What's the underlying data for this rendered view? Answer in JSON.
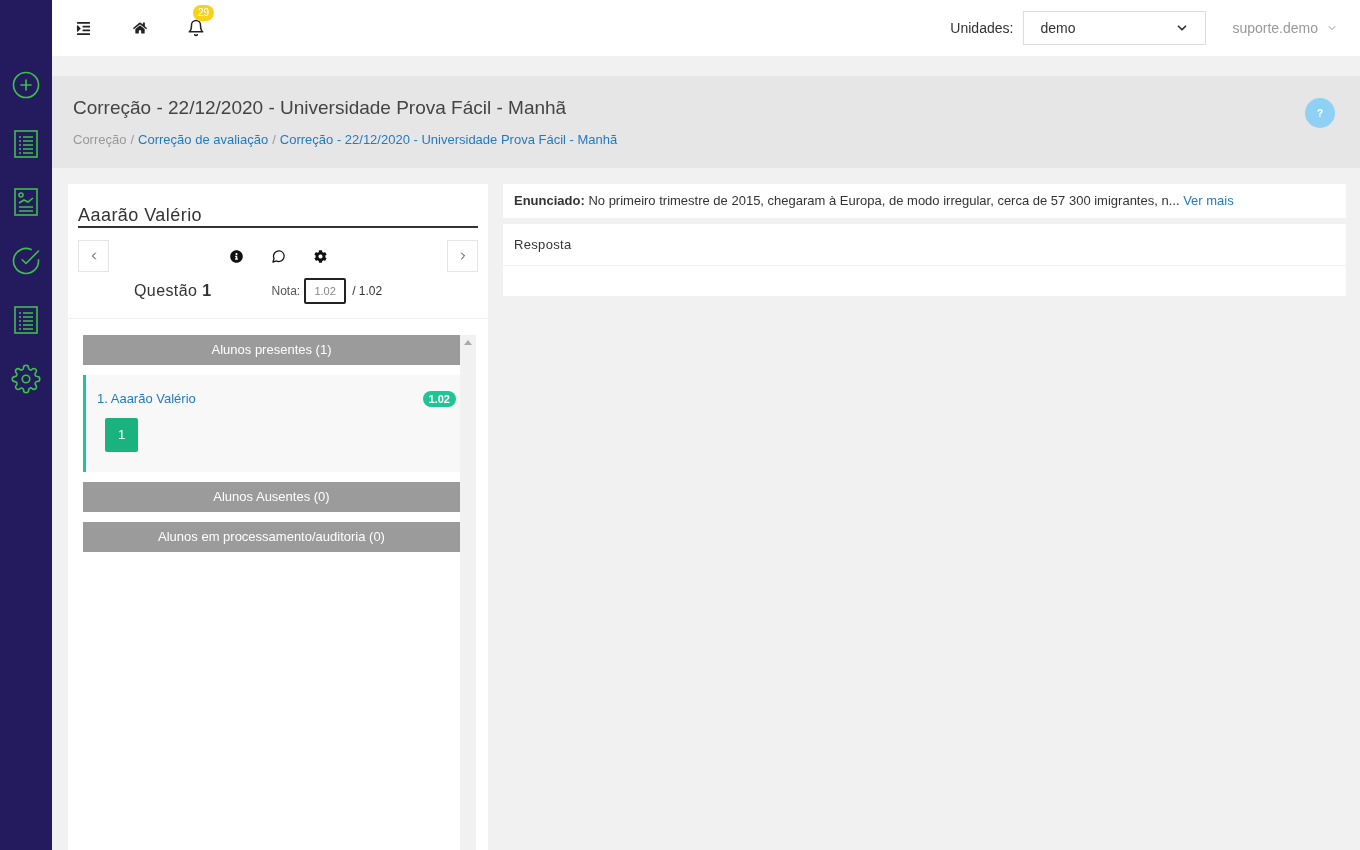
{
  "sidebar": {
    "items": [
      {
        "kind": "add"
      },
      {
        "kind": "list"
      },
      {
        "kind": "report"
      },
      {
        "kind": "check"
      },
      {
        "kind": "list"
      },
      {
        "kind": "settings"
      }
    ]
  },
  "topbar": {
    "notification_count": "29",
    "units_label": "Unidades:",
    "units_value": "demo",
    "user": "suporte.demo"
  },
  "header": {
    "title": "Correção - 22/12/2020 - Universidade Prova Fácil - Manhã",
    "breadcrumb": {
      "separator": "/",
      "items": [
        {
          "text": "Correção",
          "link": false
        },
        {
          "text": "Correção de avaliação",
          "link": true
        },
        {
          "text": "Correção - 22/12/2020 - Universidade Prova Fácil - Manhã",
          "link": true
        }
      ]
    },
    "help": "?"
  },
  "student_panel": {
    "name": "Aaarão Valério",
    "question_label": "Questão",
    "question_number": "1",
    "grade_label": "Nota:",
    "grade_value": "1.02",
    "grade_max": "/ 1.02",
    "groups": [
      {
        "title": "Alunos presentes (1)",
        "students": [
          {
            "name": "1. Aaarão Valério",
            "score": "1.02",
            "selected": true,
            "questions": [
              "1"
            ]
          }
        ]
      },
      {
        "title": "Alunos Ausentes (0)"
      },
      {
        "title": "Alunos em processamento/auditoria (0)"
      }
    ]
  },
  "statement": {
    "label": "Enunciado:",
    "text": "No primeiro trimestre de 2015, chegaram à Europa, de modo irregular, cerca de 57 300 imigrantes, n...",
    "link": "Ver mais"
  },
  "answer": {
    "label": "Resposta"
  }
}
